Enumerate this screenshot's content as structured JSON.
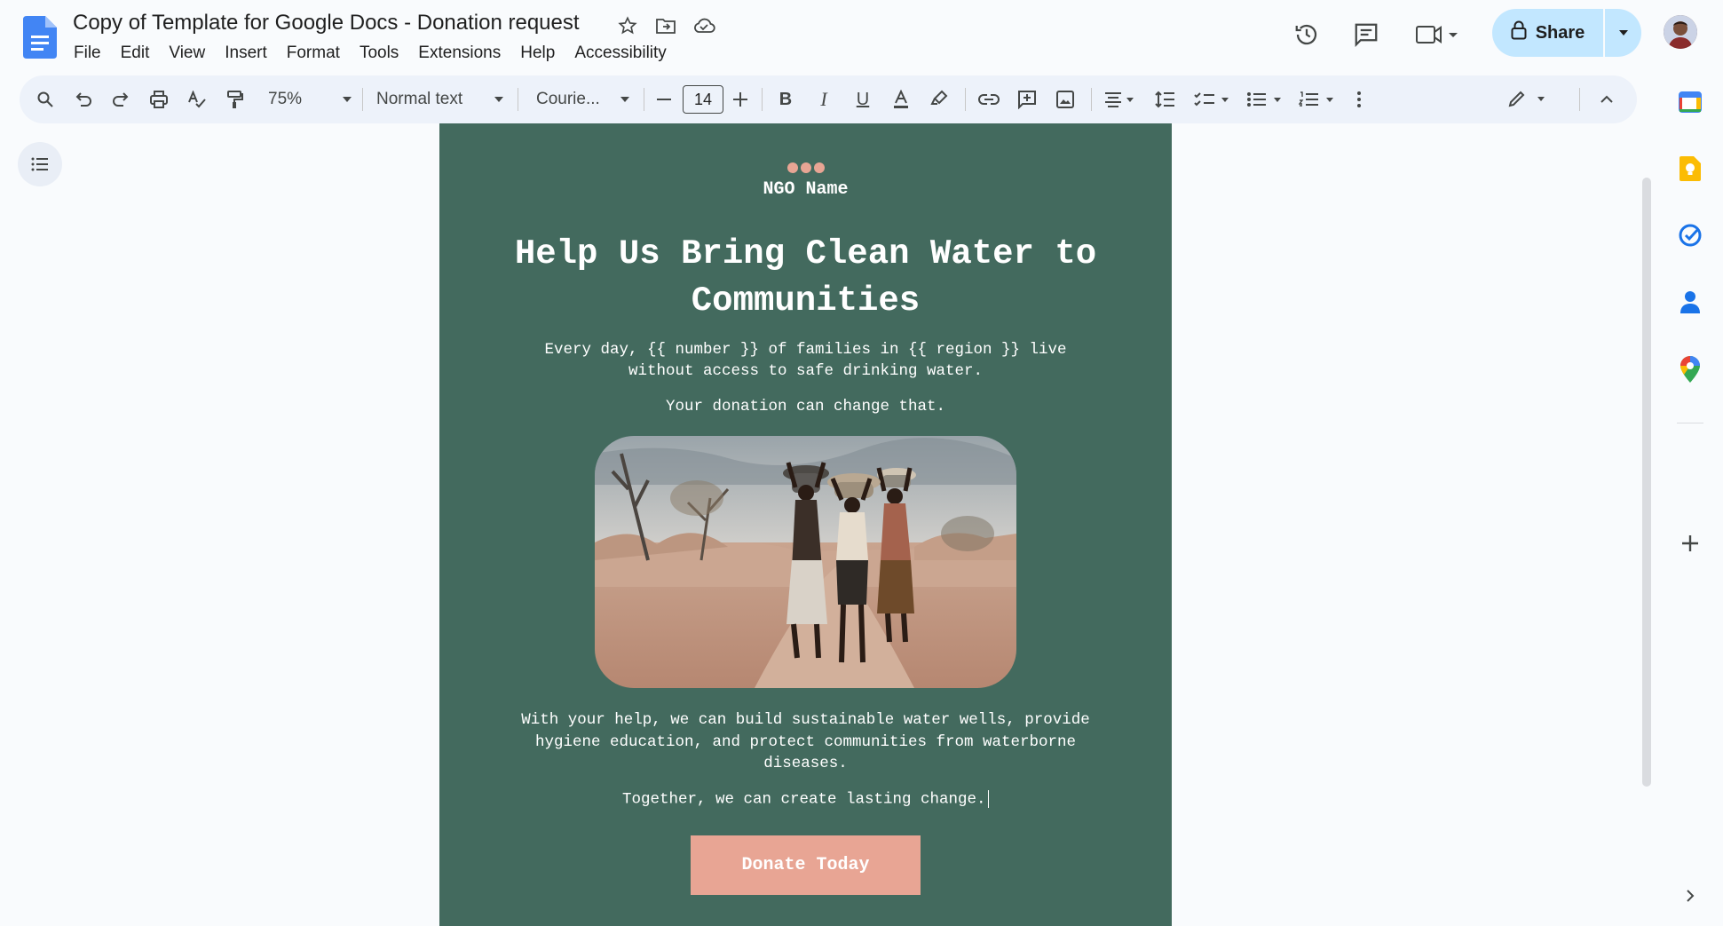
{
  "header": {
    "doc_title": "Copy of Template for Google Docs - Donation request",
    "menu": [
      "File",
      "Edit",
      "View",
      "Insert",
      "Format",
      "Tools",
      "Extensions",
      "Help",
      "Accessibility"
    ],
    "share_label": "Share",
    "icons": [
      "docs-logo-icon",
      "star-icon",
      "move-folder-icon",
      "cloud-status-icon",
      "version-history-icon",
      "comments-icon",
      "meet-icon",
      "lock-icon",
      "avatar"
    ]
  },
  "toolbar": {
    "zoom": "75%",
    "style": "Normal text",
    "font": "Courie...",
    "font_size": "14"
  },
  "document": {
    "org_name": "NGO Name",
    "headline": "Help Us Bring Clean Water to Communities",
    "intro": "Every day, {{ number }} of families in {{ region }} live without access to safe drinking water.",
    "intro2": "Your donation can change that.",
    "body": "With your help, we can build sustainable water wells, provide hygiene education, and protect communities from waterborne diseases.",
    "closing": "Together, we can create lasting change.",
    "cta": "Donate Today"
  },
  "colors": {
    "page_bg": "#436a5e",
    "accent": "#e8a594",
    "share_bg": "#c2e7ff",
    "toolbar_bg": "#edf2fa"
  },
  "side_panel": [
    "calendar-icon",
    "keep-icon",
    "tasks-icon",
    "contacts-icon",
    "maps-icon",
    "add-icon"
  ]
}
